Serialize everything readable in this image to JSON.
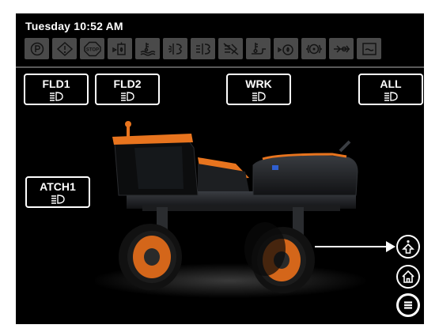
{
  "status": {
    "datetime": "Tuesday 10:52 AM"
  },
  "indicators": [
    {
      "name": "parking-brake-icon",
      "text": "(P)"
    },
    {
      "name": "warning-icon",
      "text": "!"
    },
    {
      "name": "stop-icon",
      "text": "STOP"
    },
    {
      "name": "fuel-filter-icon",
      "text": ""
    },
    {
      "name": "coolant-level-icon",
      "text": ""
    },
    {
      "name": "turn-signal-left-icon",
      "text": ""
    },
    {
      "name": "turn-signal-right-icon",
      "text": ""
    },
    {
      "name": "hazard-disabled-icon",
      "text": ""
    },
    {
      "name": "hydraulic-oil-temp-icon",
      "text": ""
    },
    {
      "name": "oil-pressure-icon",
      "text": ""
    },
    {
      "name": "brake-fault-icon",
      "text": ""
    },
    {
      "name": "battery-charge-icon",
      "text": ""
    },
    {
      "name": "def-level-icon",
      "text": ""
    }
  ],
  "lights": {
    "fld1": "FLD1",
    "fld2": "FLD2",
    "wrk": "WRK",
    "all": "ALL",
    "atch1": "ATCH1"
  },
  "colors": {
    "screen_bg": "#000000",
    "indicator_off": "#4a4a4a",
    "vehicle_accent": "#e8741e"
  }
}
